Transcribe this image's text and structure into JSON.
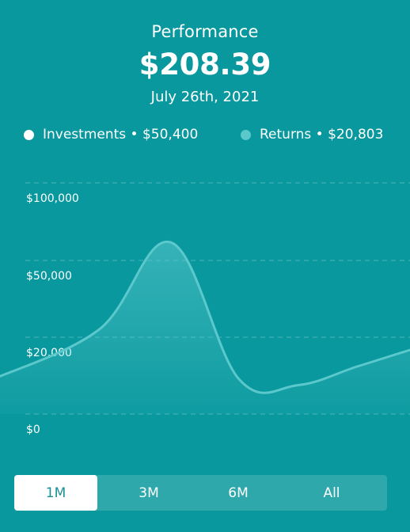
{
  "header": {
    "title": "Performance",
    "value": "$208.39",
    "date": "July 26th, 2021"
  },
  "legend": [
    {
      "label": "Investments • $50,400",
      "color": "#ffffff"
    },
    {
      "label": "Returns • $20,803",
      "color": "#5bc8cc"
    }
  ],
  "colors": {
    "background": "#08989e",
    "line": "#5bc8cc",
    "area": "#3fb3b6",
    "tab_bar": "#2ea8ab",
    "tab_active_bg": "#ffffff",
    "tab_active_text": "#1a8f95"
  },
  "chart_data": {
    "type": "area",
    "yticks": [
      "$100,000",
      "$50,000",
      "$20,000",
      "$0"
    ],
    "series": [
      {
        "name": "Returns",
        "x": [
          0,
          0.25,
          0.42,
          0.58,
          0.72,
          0.86,
          1.0
        ],
        "values": [
          4,
          12,
          26,
          4,
          3,
          6,
          9
        ]
      }
    ],
    "grid": true
  },
  "range_tabs": [
    {
      "label": "1M",
      "active": true
    },
    {
      "label": "3M",
      "active": false
    },
    {
      "label": "6M",
      "active": false
    },
    {
      "label": "All",
      "active": false
    }
  ]
}
